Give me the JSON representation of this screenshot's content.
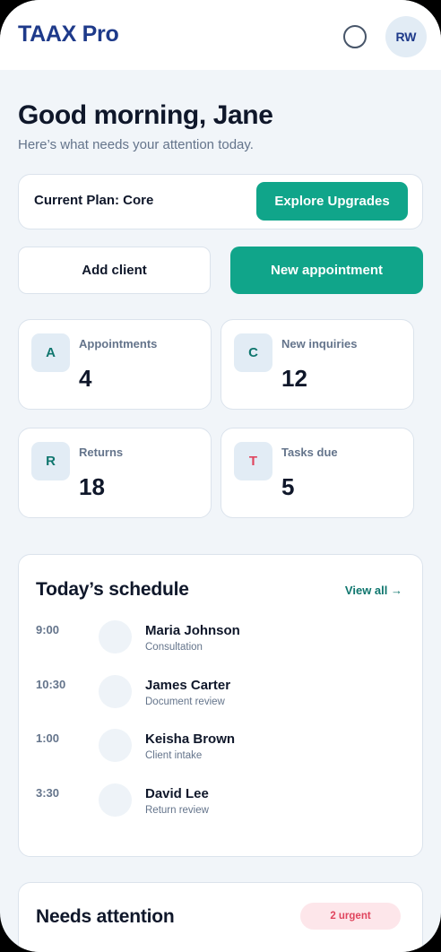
{
  "header": {
    "brand": "TAAX Pro",
    "avatar_initials": "RW"
  },
  "greeting": {
    "title": "Good morning, Jane",
    "subtitle": "Here’s what needs your attention today."
  },
  "plan": {
    "label": "Current Plan: Core",
    "upgrade_label": "Explore Upgrades"
  },
  "actions": {
    "add_client": "Add client",
    "new_appointment": "New appointment"
  },
  "stats": [
    {
      "letter": "A",
      "label": "Appointments",
      "value": "4",
      "color": "#0f766e"
    },
    {
      "letter": "C",
      "label": "New inquiries",
      "value": "12",
      "color": "#0f766e"
    },
    {
      "letter": "R",
      "label": "Returns",
      "value": "18",
      "color": "#0f766e"
    },
    {
      "letter": "T",
      "label": "Tasks due",
      "value": "5",
      "color": "#e0455e"
    }
  ],
  "schedule": {
    "title": "Today’s schedule",
    "view_all": "View all →",
    "items": [
      {
        "time": "9:00",
        "name": "Maria Johnson",
        "detail": "Consultation"
      },
      {
        "time": "10:30",
        "name": "James Carter",
        "detail": "Document review"
      },
      {
        "time": "1:00",
        "name": "Keisha Brown",
        "detail": "Client intake"
      },
      {
        "time": "3:30",
        "name": "David Lee",
        "detail": "Return review"
      }
    ]
  },
  "attention": {
    "title": "Needs attention",
    "badge": "2 urgent"
  },
  "colors": {
    "accent": "#10a58a",
    "brand": "#1e3a8a",
    "urgent": "#e0455e"
  }
}
